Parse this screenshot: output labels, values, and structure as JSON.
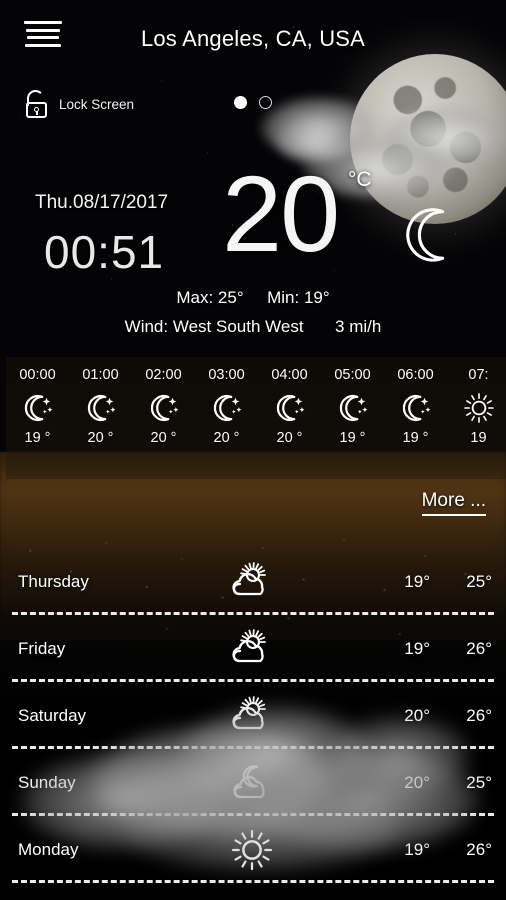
{
  "header": {
    "menu_icon": "hamburger-menu-icon",
    "city": "Los Angeles, CA, USA",
    "lock": {
      "icon": "unlock-icon",
      "label": "Lock Screen"
    },
    "page_dots": [
      {
        "state": "active"
      },
      {
        "state": "idle"
      }
    ]
  },
  "current": {
    "date": "Thu.08/17/2017",
    "time": "00:51",
    "temperature": "20",
    "unit": "°C",
    "condition_icon": "crescent-moon-icon",
    "max_label": "Max:",
    "max_value": "25°",
    "min_label": "Min:",
    "min_value": "19°",
    "wind_label": "Wind:",
    "wind_direction": "West South West",
    "wind_speed": "3 mi/h"
  },
  "hourly": {
    "items": [
      {
        "time": "00:00",
        "icon": "moon-stars-icon",
        "temp": "19 °"
      },
      {
        "time": "01:00",
        "icon": "moon-stars-icon",
        "temp": "20 °"
      },
      {
        "time": "02:00",
        "icon": "moon-stars-icon",
        "temp": "20 °"
      },
      {
        "time": "03:00",
        "icon": "moon-stars-icon",
        "temp": "20 °"
      },
      {
        "time": "04:00",
        "icon": "moon-stars-icon",
        "temp": "20 °"
      },
      {
        "time": "05:00",
        "icon": "moon-stars-icon",
        "temp": "19 °"
      },
      {
        "time": "06:00",
        "icon": "moon-stars-icon",
        "temp": "19 °"
      },
      {
        "time": "07:",
        "icon": "sun-icon",
        "temp": "19"
      }
    ]
  },
  "more": {
    "label": "More ..."
  },
  "daily": {
    "items": [
      {
        "day": "Thursday",
        "icon": "sun-behind-cloud-icon",
        "low": "19°",
        "high": "25°"
      },
      {
        "day": "Friday",
        "icon": "sun-behind-cloud-icon",
        "low": "19°",
        "high": "26°"
      },
      {
        "day": "Saturday",
        "icon": "sun-behind-cloud-icon",
        "low": "20°",
        "high": "26°"
      },
      {
        "day": "Sunday",
        "icon": "moon-behind-cloud-icon",
        "low": "20°",
        "high": "25°"
      },
      {
        "day": "Monday",
        "icon": "sun-icon",
        "low": "19°",
        "high": "26°"
      }
    ]
  },
  "colors": {
    "text": "#ffffff",
    "background": "#000000",
    "city_glow": "#d9a05a"
  }
}
